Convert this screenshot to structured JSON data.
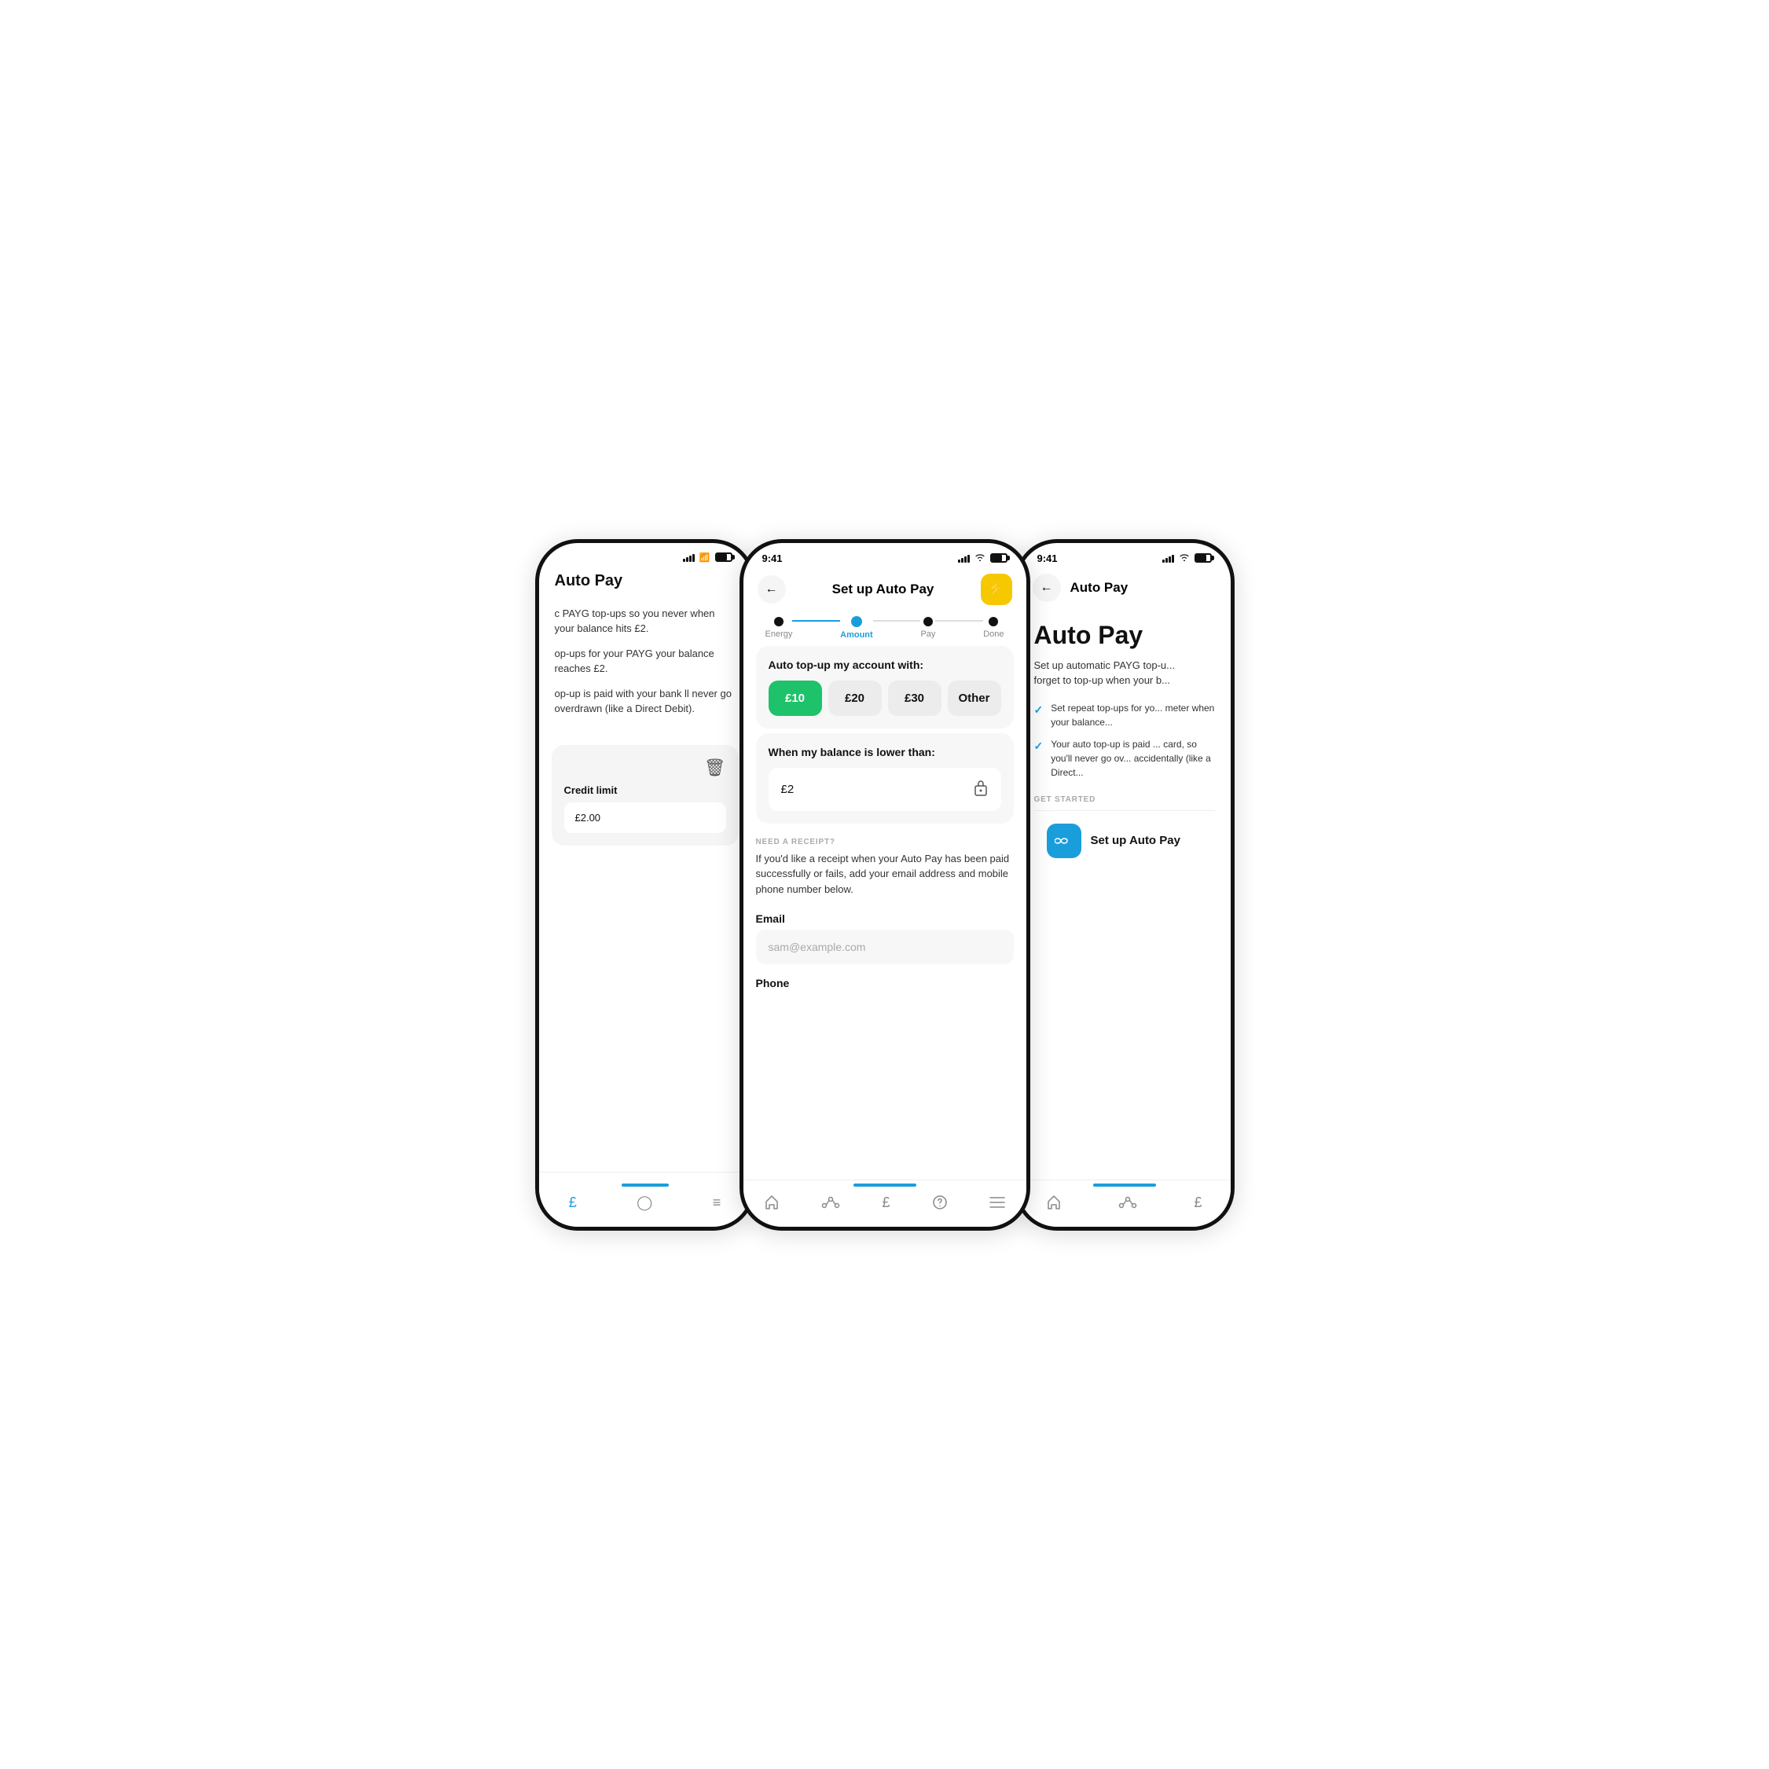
{
  "phones": {
    "left": {
      "page_title": "Auto Pay",
      "body1": "c PAYG top-ups so you never when your balance hits £2.",
      "body2": "op-ups for your PAYG your balance reaches £2.",
      "body3": "op-up is paid with your bank ll never go overdrawn (like a Direct Debit).",
      "card": {
        "label": "Credit limit",
        "value": "£2.00"
      },
      "nav_items": [
        "£",
        "?",
        "≡"
      ],
      "active_nav": 0
    },
    "center": {
      "status": {
        "time": "9:41"
      },
      "header": {
        "back_label": "←",
        "title": "Set up Auto Pay",
        "action_icon": "⚡"
      },
      "steps": [
        {
          "label": "Energy",
          "state": "done"
        },
        {
          "label": "Amount",
          "state": "active"
        },
        {
          "label": "Pay",
          "state": "default"
        },
        {
          "label": "Done",
          "state": "default"
        }
      ],
      "top_up_section": {
        "title": "Auto top-up my account with:",
        "options": [
          {
            "value": "£10",
            "selected": true
          },
          {
            "value": "£20",
            "selected": false
          },
          {
            "value": "£30",
            "selected": false
          },
          {
            "value": "Other",
            "selected": false
          }
        ]
      },
      "balance_section": {
        "title": "When my balance is lower than:",
        "value": "£2"
      },
      "receipt_section": {
        "label": "NEED A RECEIPT?",
        "text": "If you'd like a receipt when your Auto Pay has been paid successfully or fails, add your email address and mobile phone number below."
      },
      "email_field": {
        "label": "Email",
        "placeholder": "sam@example.com"
      },
      "phone_field": {
        "label": "Phone",
        "placeholder": ""
      },
      "nav_items": [
        "🏠",
        "∿∿",
        "£",
        "?",
        "≡"
      ]
    },
    "right": {
      "status": {
        "time": "9:41"
      },
      "header": {
        "back_label": "←",
        "title": "Auto Pay"
      },
      "main_title": "Auto Pay",
      "description": "Set up automatic PAYG top-u... forget to top-up when your b...",
      "bullets": [
        "Set repeat top-ups for yo... meter when your balance...",
        "Your auto top-up is paid ... card, so you'll never go ov... accidentally (like a Direct..."
      ],
      "get_started_label": "GET STARTED",
      "setup_button": {
        "icon": "∞",
        "text": "Set up Auto Pay"
      },
      "nav_items": [
        "🏠",
        "∿∿",
        "£"
      ]
    }
  }
}
